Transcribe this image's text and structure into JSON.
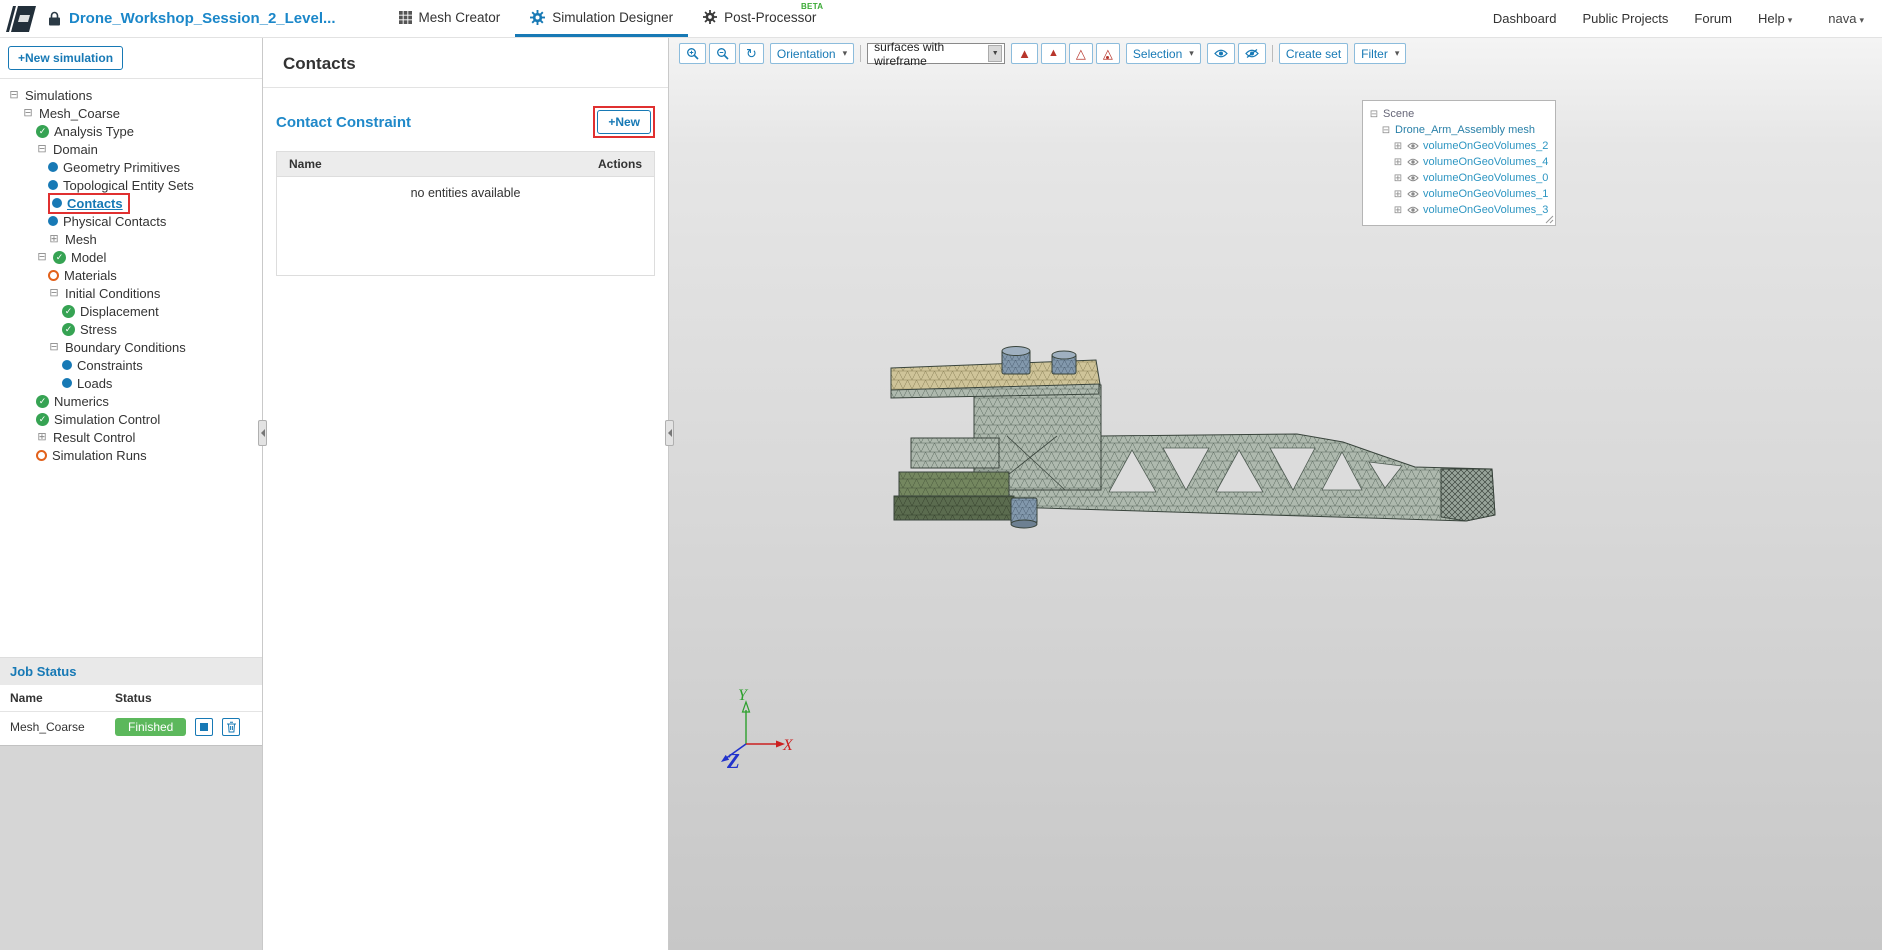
{
  "topbar": {
    "project_title": "Drone_Workshop_Session_2_Level...",
    "tabs": [
      {
        "label": "Mesh Creator"
      },
      {
        "label": "Simulation Designer"
      },
      {
        "label": "Post-Processor",
        "beta": "BETA"
      }
    ],
    "links": {
      "dashboard": "Dashboard",
      "public_projects": "Public Projects",
      "forum": "Forum",
      "help": "Help",
      "user": "nava"
    }
  },
  "glyphs": {
    "dropdown": "▾",
    "select_arrow": "▼",
    "expander_open": "⊟",
    "expander_closed": "⊞",
    "refresh": "↻",
    "check": "✓",
    "triangle_filled": "▲",
    "triangle_outline": "△"
  },
  "sidebar": {
    "new_simulation_button": "+New simulation",
    "tree": [
      {
        "label": "Simulations",
        "icon": "collapse-icon"
      },
      {
        "label": "Mesh_Coarse",
        "icon": "collapse-icon"
      },
      {
        "label": "Analysis Type",
        "icon": "check-icon"
      },
      {
        "label": "Domain",
        "icon": "collapse-icon"
      },
      {
        "label": "Geometry Primitives",
        "icon": "blue-dot-icon"
      },
      {
        "label": "Topological Entity Sets",
        "icon": "blue-dot-icon"
      },
      {
        "label": "Contacts",
        "icon": "blue-dot-icon",
        "selected": true
      },
      {
        "label": "Physical Contacts",
        "icon": "blue-dot-icon"
      },
      {
        "label": "Mesh",
        "icon": "expand-icon"
      },
      {
        "label": "Model",
        "icon": "check-icon"
      },
      {
        "label": "Materials",
        "icon": "orange-ring-icon"
      },
      {
        "label": "Initial Conditions",
        "icon": "collapse-icon"
      },
      {
        "label": "Displacement",
        "icon": "check-icon"
      },
      {
        "label": "Stress",
        "icon": "check-icon"
      },
      {
        "label": "Boundary Conditions",
        "icon": "collapse-icon"
      },
      {
        "label": "Constraints",
        "icon": "blue-dot-icon"
      },
      {
        "label": "Loads",
        "icon": "blue-dot-icon"
      },
      {
        "label": "Numerics",
        "icon": "check-icon"
      },
      {
        "label": "Simulation Control",
        "icon": "check-icon"
      },
      {
        "label": "Result Control",
        "icon": "expand-icon"
      },
      {
        "label": "Simulation Runs",
        "icon": "orange-ring-icon"
      }
    ],
    "job_status": {
      "title": "Job Status",
      "columns": {
        "name": "Name",
        "status": "Status"
      },
      "rows": [
        {
          "name": "Mesh_Coarse",
          "status": "Finished"
        }
      ]
    }
  },
  "contacts_panel": {
    "title": "Contacts",
    "section_title": "Contact Constraint",
    "new_button": "+New",
    "columns": {
      "name": "Name",
      "actions": "Actions"
    },
    "empty_text": "no entities available"
  },
  "viewport": {
    "toolbar": {
      "orientation": "Orientation",
      "render_mode": "surfaces with wireframe",
      "selection": "Selection",
      "create_set": "Create set",
      "filter": "Filter"
    },
    "scene_tree": {
      "root": "Scene",
      "mesh": "Drone_Arm_Assembly mesh",
      "volumes": [
        "volumeOnGeoVolumes_2",
        "volumeOnGeoVolumes_4",
        "volumeOnGeoVolumes_0",
        "volumeOnGeoVolumes_1",
        "volumeOnGeoVolumes_3"
      ]
    },
    "axes": {
      "x": "X",
      "y": "Y",
      "z": "Z"
    },
    "colors": {
      "accent_blue": "#1779b5",
      "axis_x_red": "#cc2020",
      "axis_y_green": "#2ca02c",
      "axis_z_blue": "#2233cc",
      "mesh_body": "#aeb9ae",
      "mesh_plate_tan": "#cfc499",
      "mesh_olive": "#74875f",
      "mesh_dark_olive": "#5b6c4f",
      "mesh_bolt_blue": "#8298ac",
      "finished_green": "#5cb85c",
      "highlight_red": "#e03030"
    }
  }
}
